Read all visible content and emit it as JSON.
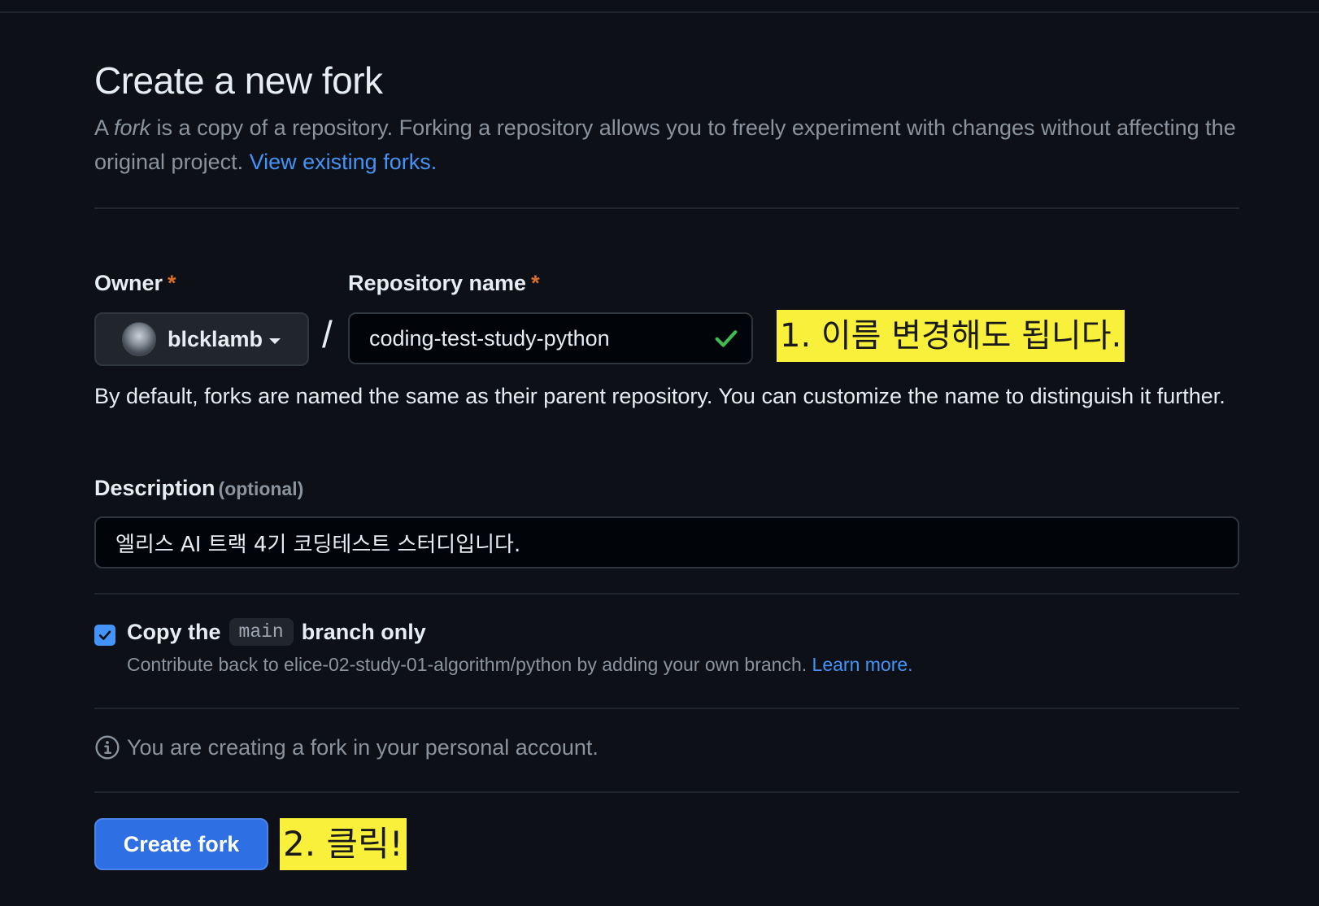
{
  "page": {
    "title": "Create a new fork",
    "intro_before": "A ",
    "intro_fork_word": "fork",
    "intro_after": " is a copy of a repository. Forking a repository allows you to freely experiment with changes without affecting the original project. ",
    "view_forks_link": "View existing forks."
  },
  "owner": {
    "label": "Owner",
    "required_mark": "*",
    "value": "blcklamb",
    "avatar_icon": "user-avatar"
  },
  "separator": "/",
  "repository": {
    "label": "Repository name",
    "required_mark": "*",
    "value": "coding-test-study-python",
    "status_icon": "check-icon",
    "status_color": "#3fb950"
  },
  "annotations": {
    "step1": "1. 이름 변경해도 됩니다.",
    "step2": "2. 클릭!",
    "highlight_color": "#f8f03a"
  },
  "hint": "By default, forks are named the same as their parent repository. You can customize the name to distinguish it further.",
  "description": {
    "label": "Description",
    "optional_label": "(optional)",
    "value": "엘리스 AI 트랙 4기 코딩테스트 스터디입니다."
  },
  "branch_option": {
    "checked": true,
    "label_before": "Copy the",
    "branch_name": "main",
    "label_after": "branch only",
    "sub_text": "Contribute back to elice-02-study-01-algorithm/python by adding your own branch. ",
    "learn_more_link": "Learn more."
  },
  "info": {
    "icon": "info-icon",
    "text": "You are creating a fork in your personal account."
  },
  "actions": {
    "create_fork_label": "Create fork",
    "accent_color": "#2f6fe4"
  }
}
